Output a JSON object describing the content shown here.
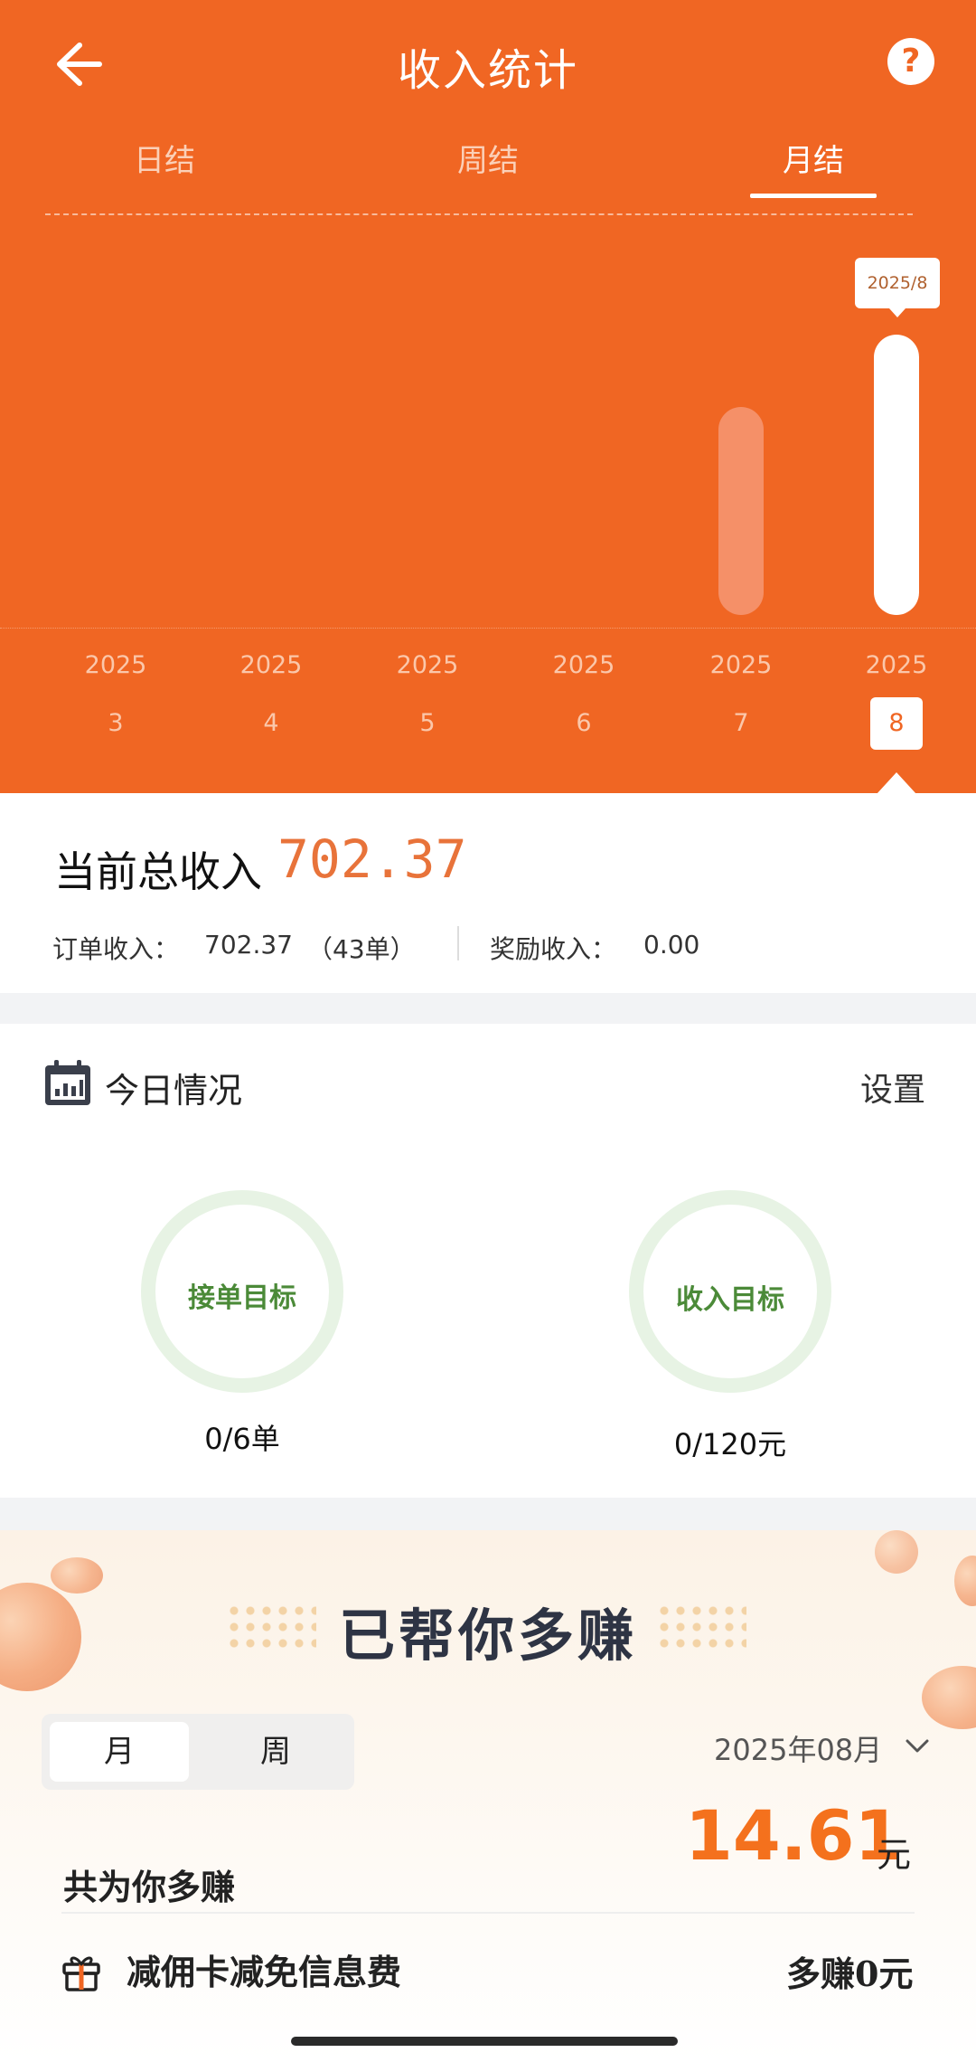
{
  "header": {
    "title": "收入统计",
    "tabs": [
      {
        "label": "日结",
        "active": false
      },
      {
        "label": "周结",
        "active": false
      },
      {
        "label": "月结",
        "active": true
      }
    ],
    "accent_color": "#F06623"
  },
  "chart_data": {
    "type": "bar",
    "categories": [
      "2025/3",
      "2025/4",
      "2025/5",
      "2025/6",
      "2025/7",
      "2025/8"
    ],
    "x_year_labels": [
      "2025",
      "2025",
      "2025",
      "2025",
      "2025",
      "2025"
    ],
    "x_month_labels": [
      "3",
      "4",
      "5",
      "6",
      "7",
      "8"
    ],
    "values": [
      0,
      0,
      0,
      0,
      520,
      702.37
    ],
    "selected_index": 5,
    "tooltip": "2025/8",
    "ylim": [
      0,
      720
    ],
    "grid": false,
    "colors": {
      "bar": "#F59068",
      "selected_bar": "#FFFFFF"
    }
  },
  "summary": {
    "total_label": "当前总收入",
    "total_value": "702.37",
    "order_label": "订单收入：",
    "order_value": "702.37",
    "order_count": "（43单）",
    "reward_label": "奖励收入：",
    "reward_value": "0.00"
  },
  "today": {
    "title": "今日情况",
    "settings": "设置",
    "goals": [
      {
        "label": "接单目标",
        "value": "0/6单",
        "progress": 0
      },
      {
        "label": "收入目标",
        "value": "0/120元",
        "progress": 0
      }
    ]
  },
  "promo": {
    "title": "已帮你多赚",
    "segments": [
      {
        "label": "月",
        "active": true
      },
      {
        "label": "周",
        "active": false
      }
    ],
    "month_selector": "2025年08月",
    "extra_value": "14.61",
    "extra_unit": "元",
    "extra_label": "共为你多赚",
    "rows": [
      {
        "label": "减佣卡减免信息费",
        "value": "多赚0元",
        "icon": "gift-icon"
      }
    ]
  }
}
